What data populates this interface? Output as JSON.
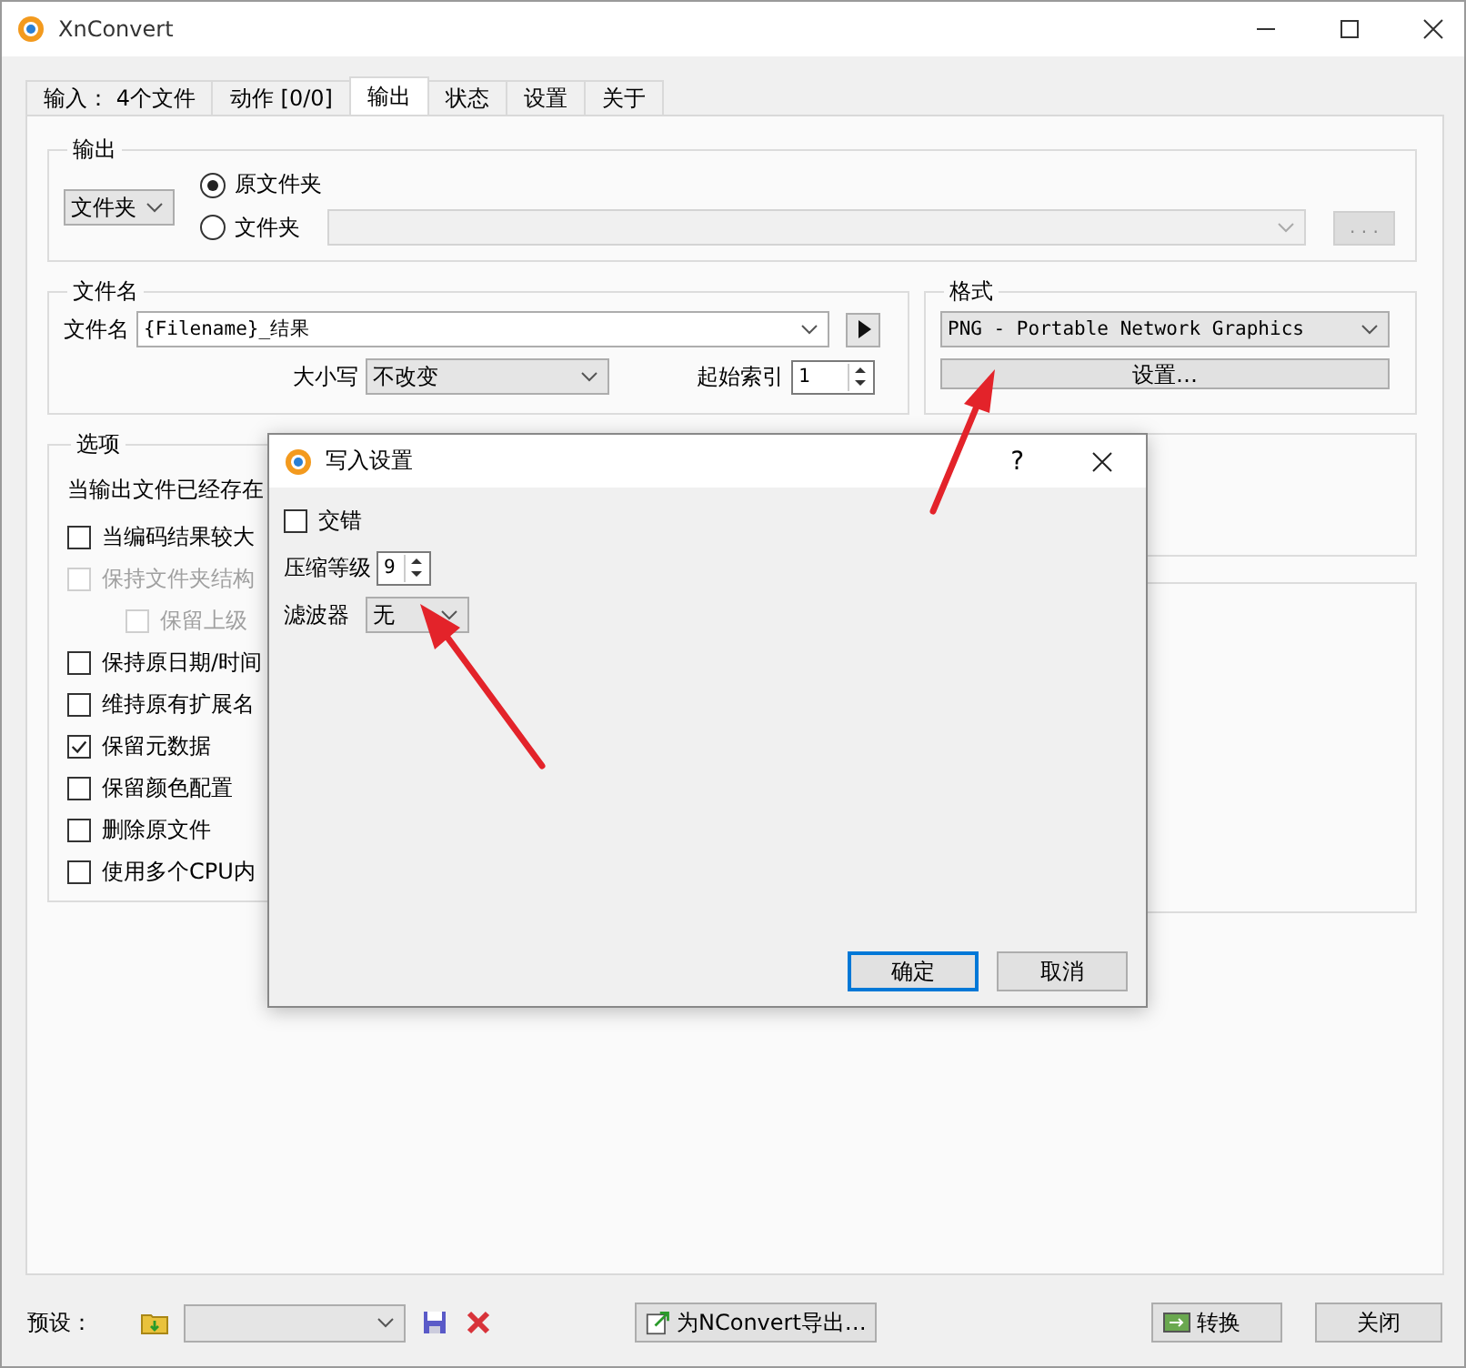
{
  "window": {
    "title": "XnConvert"
  },
  "tabs": [
    {
      "label": "输入： 4个文件",
      "selected": false
    },
    {
      "label": "动作 [0/0]",
      "selected": false
    },
    {
      "label": "输出",
      "selected": true
    },
    {
      "label": "状态",
      "selected": false
    },
    {
      "label": "设置",
      "selected": false
    },
    {
      "label": "关于",
      "selected": false
    }
  ],
  "output": {
    "title": "输出",
    "mode": "文件夹",
    "destinations": [
      {
        "label": "原文件夹",
        "selected": true
      },
      {
        "label": "文件夹",
        "selected": false
      }
    ],
    "browse": ". . ."
  },
  "filename": {
    "title": "文件名",
    "label": "文件名",
    "value": "{Filename}_结果",
    "case_label": "大小写",
    "case_value": "不改变",
    "index_label": "起始索引",
    "index_value": "1"
  },
  "format": {
    "title": "格式",
    "value": "PNG - Portable Network Graphics",
    "settings_button": "设置…"
  },
  "options": {
    "title": "选项",
    "items": [
      {
        "kind": "text",
        "label": "当输出文件已经存在"
      },
      {
        "kind": "checkbox",
        "label": "当编码结果较大",
        "checked": false,
        "disabled": false
      },
      {
        "kind": "checkbox",
        "label": "保持文件夹结构",
        "checked": false,
        "disabled": true,
        "children": [
          {
            "label": "保留上级",
            "checked": false,
            "disabled": true
          }
        ]
      },
      {
        "kind": "checkbox",
        "label": "保持原日期/时间",
        "checked": false,
        "disabled": false
      },
      {
        "kind": "checkbox",
        "label": "维持原有扩展名",
        "checked": false,
        "disabled": false
      },
      {
        "kind": "checkbox",
        "label": "保留元数据",
        "checked": true,
        "disabled": false
      },
      {
        "kind": "checkbox",
        "label": "保留颜色配置",
        "checked": false,
        "disabled": false
      },
      {
        "kind": "checkbox",
        "label": "删除原文件",
        "checked": false,
        "disabled": false
      },
      {
        "kind": "checkbox",
        "label": "使用多个CPU内",
        "checked": false,
        "disabled": false
      }
    ]
  },
  "dialog": {
    "title": "写入设置",
    "help": "?",
    "interlace": {
      "label": "交错",
      "checked": false
    },
    "compression": {
      "label": "压缩等级",
      "value": "9"
    },
    "filter": {
      "label": "滤波器",
      "value": "无"
    },
    "buttons": [
      {
        "label": "确定",
        "default": true
      },
      {
        "label": "取消",
        "default": false
      }
    ]
  },
  "bottom": {
    "preset_label": "预设：",
    "export_button": "为NConvert导出…",
    "convert_button": "转换",
    "close_button": "关闭"
  }
}
